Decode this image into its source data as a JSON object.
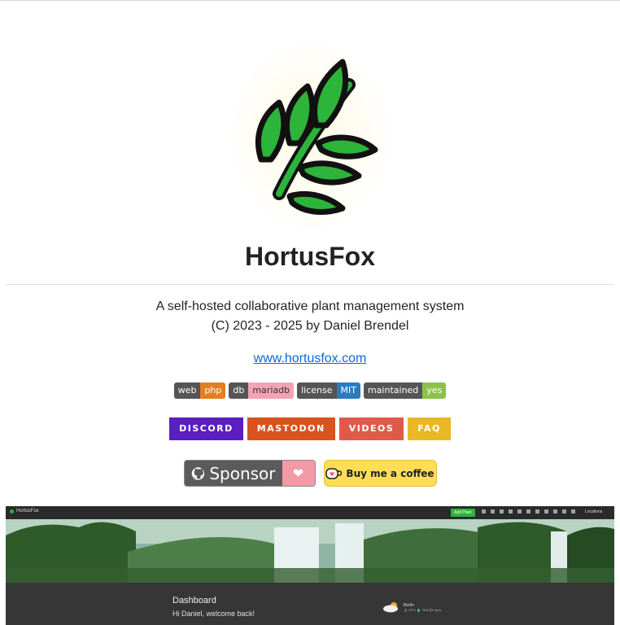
{
  "project": {
    "name": "HortusFox",
    "tagline": "A self-hosted collaborative plant management system",
    "copyright": "(C) 2023 - 2025 by Daniel Brendel",
    "website": "www.hortusfox.com"
  },
  "badges": [
    {
      "key": "web",
      "value": "php",
      "color": "#e67e22"
    },
    {
      "key": "db",
      "value": "mariadb",
      "color": "#f4a3b4"
    },
    {
      "key": "license",
      "value": "MIT",
      "color": "#2b7bbf"
    },
    {
      "key": "maintained",
      "value": "yes",
      "color": "#8bc34a"
    }
  ],
  "social_buttons": [
    {
      "label": "DISCORD",
      "color": "#5b1ebf"
    },
    {
      "label": "MASTODON",
      "color": "#d9531e"
    },
    {
      "label": "VIDEOS",
      "color": "#e05a4a"
    },
    {
      "label": "FAQ",
      "color": "#e9b824"
    }
  ],
  "sponsor": {
    "github_label": "Sponsor",
    "bmc_label": "Buy me a coffee"
  },
  "screenshot": {
    "brand": "HortusFox",
    "add_button": "Add Plant",
    "locations_label": "Locations",
    "dashboard_title": "Dashboard",
    "welcome_text": "Hi Daniel, welcome back!",
    "weather_city": "Berlin",
    "weather_stats": "🌡 20°C  💧 75%  🌬 4m/s"
  },
  "colors": {
    "leaf": "#2db43b",
    "leaf_outline": "#111111",
    "link": "#0969da"
  },
  "icons": {
    "logo": "leaf-logo-icon",
    "github": "github-icon",
    "heart": "heart-icon",
    "coffee": "coffee-cup-icon"
  }
}
